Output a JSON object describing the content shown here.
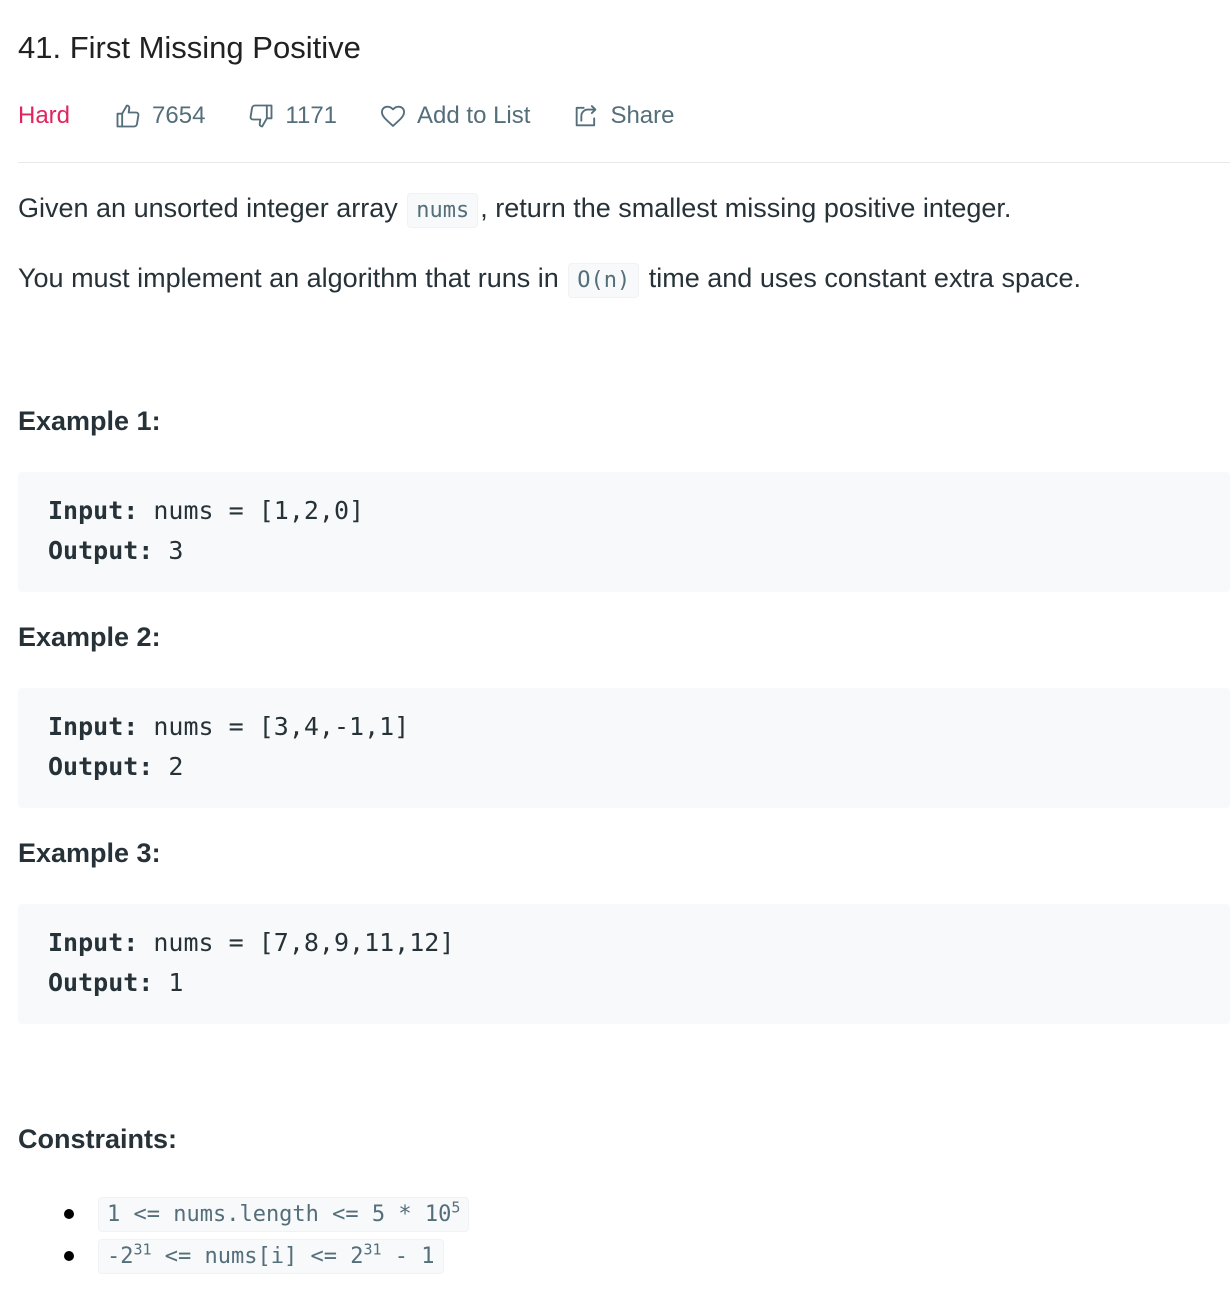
{
  "problem": {
    "title": "41. First Missing Positive",
    "difficulty": "Hard",
    "likes": "7654",
    "dislikes": "1171",
    "add_to_list": "Add to List",
    "share": "Share"
  },
  "description": {
    "p1_before": "Given an unsorted integer array ",
    "p1_code": "nums",
    "p1_after": ", return the smallest missing positive integer.",
    "p2_before": "You must implement an algorithm that runs in ",
    "p2_code": "O(n)",
    "p2_after": " time and uses constant extra space."
  },
  "examples": [
    {
      "title": "Example 1:",
      "input_label": "Input:",
      "input_value": " nums = [1,2,0]",
      "output_label": "Output:",
      "output_value": " 3"
    },
    {
      "title": "Example 2:",
      "input_label": "Input:",
      "input_value": " nums = [3,4,-1,1]",
      "output_label": "Output:",
      "output_value": " 2"
    },
    {
      "title": "Example 3:",
      "input_label": "Input:",
      "input_value": " nums = [7,8,9,11,12]",
      "output_label": "Output:",
      "output_value": " 1"
    }
  ],
  "constraints": {
    "title": "Constraints:",
    "c1_text": "1 <= nums.length <= 5 * 10",
    "c1_sup": "5",
    "c2_a": "-2",
    "c2_sup1": "31",
    "c2_b": " <= nums[i] <= 2",
    "c2_sup2": "31",
    "c2_c": " - 1"
  },
  "colors": {
    "difficulty_hard": "#e0245e",
    "meta_text": "#546e7a",
    "code_bg": "#f7f9fa"
  },
  "icons": {
    "likes": "thumbs-up-icon",
    "dislikes": "thumbs-down-icon",
    "add_to_list": "heart-icon",
    "share": "share-icon"
  }
}
